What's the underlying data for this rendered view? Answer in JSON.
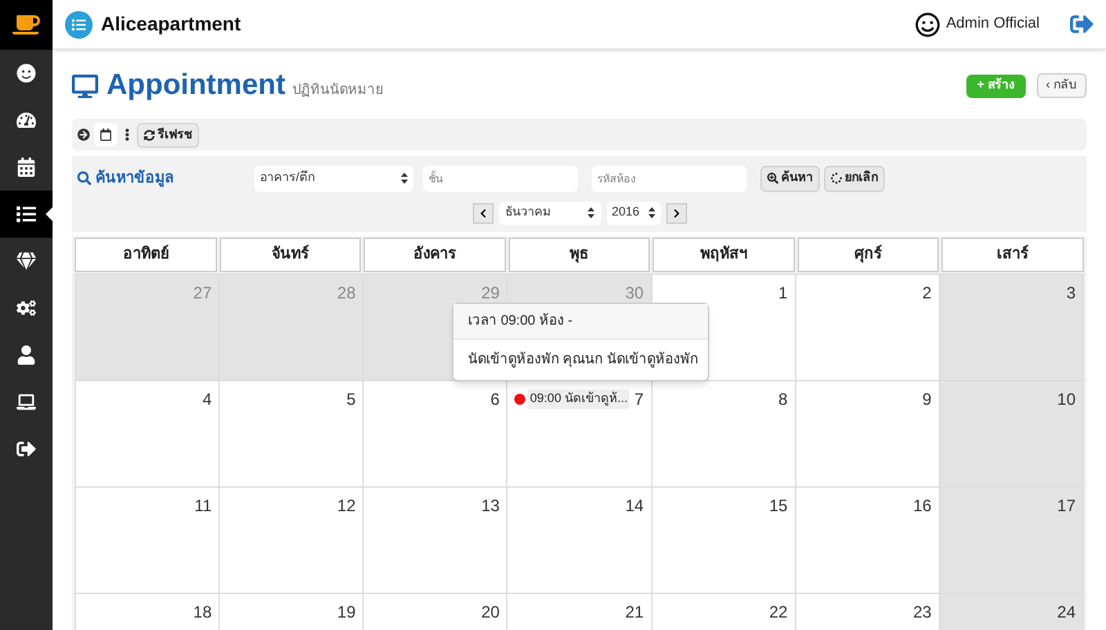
{
  "app": {
    "name": "Aliceapartment",
    "user": "Admin Official"
  },
  "sidebar": {
    "items": [
      {
        "selected": false
      },
      {
        "selected": false
      },
      {
        "selected": false
      },
      {
        "selected": true
      },
      {
        "selected": false
      },
      {
        "selected": false
      },
      {
        "selected": false
      },
      {
        "selected": false
      },
      {
        "selected": false
      }
    ]
  },
  "page": {
    "title": "Appointment",
    "subtitle": "ปฏิทินนัดหมาย",
    "create_button": "+ สร้าง",
    "back_button": "‹ กลับ"
  },
  "toolbar": {
    "refresh_button": "รีเฟรช"
  },
  "search": {
    "label": "ค้นหาข้อมูล",
    "building": "อาคาร/ตึก",
    "floor_placeholder": "ชั้น",
    "room_placeholder": "รหัสห้อง",
    "search_button": "ค้นหา",
    "cancel_button": "ยกเลิก"
  },
  "month_nav": {
    "month": "ธันวาคม",
    "year": "2016"
  },
  "calendar": {
    "weekdays": [
      "อาทิตย์",
      "จันทร์",
      "อังคาร",
      "พุธ",
      "พฤหัสฯ",
      "ศุกร์",
      "เสาร์"
    ],
    "weeks": [
      [
        {
          "day": "27",
          "shaded": true
        },
        {
          "day": "28",
          "shaded": true
        },
        {
          "day": "29",
          "shaded": true
        },
        {
          "day": "30",
          "shaded": true
        },
        {
          "day": "1",
          "shaded": false
        },
        {
          "day": "2",
          "shaded": false
        },
        {
          "day": "3",
          "shaded": true
        }
      ],
      [
        {
          "day": "4",
          "shaded": false
        },
        {
          "day": "5",
          "shaded": false
        },
        {
          "day": "6",
          "shaded": false
        },
        {
          "day": "7",
          "shaded": false,
          "events": [
            {
              "text": "09:00 นัดเข้าดูห้...",
              "color": "#ee1111",
              "tooltip": {
                "title": "เวลา 09:00 ห้อง -",
                "body": "นัดเข้าดูห้องพัก คุณนก นัดเข้าดูห้องพัก"
              }
            }
          ]
        },
        {
          "day": "8",
          "shaded": false
        },
        {
          "day": "9",
          "shaded": false
        },
        {
          "day": "10",
          "shaded": true
        }
      ],
      [
        {
          "day": "11",
          "shaded": false
        },
        {
          "day": "12",
          "shaded": false
        },
        {
          "day": "13",
          "shaded": false
        },
        {
          "day": "14",
          "shaded": false
        },
        {
          "day": "15",
          "shaded": false
        },
        {
          "day": "16",
          "shaded": false
        },
        {
          "day": "17",
          "shaded": true
        }
      ],
      [
        {
          "day": "18",
          "shaded": false
        },
        {
          "day": "19",
          "shaded": false
        },
        {
          "day": "20",
          "shaded": false
        },
        {
          "day": "21",
          "shaded": false
        },
        {
          "day": "22",
          "shaded": false
        },
        {
          "day": "23",
          "shaded": false
        },
        {
          "day": "24",
          "shaded": true
        }
      ]
    ]
  }
}
